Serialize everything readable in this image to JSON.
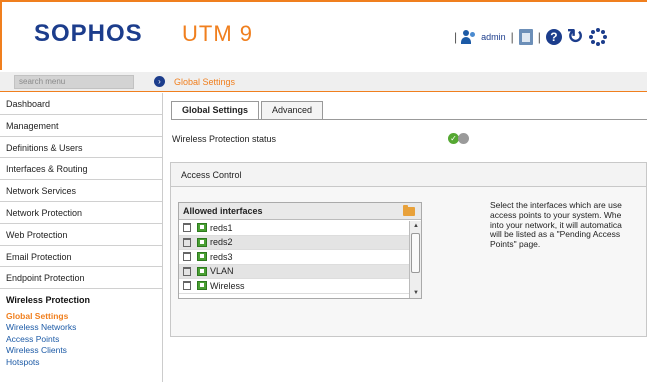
{
  "header": {
    "brand": "SOPHOS",
    "product": "UTM 9",
    "user": "admin"
  },
  "search": {
    "placeholder": "search menu"
  },
  "breadcrumb": "Global Settings",
  "sidebar": {
    "items": [
      {
        "label": "Dashboard"
      },
      {
        "label": "Management"
      },
      {
        "label": "Definitions & Users"
      },
      {
        "label": "Interfaces & Routing"
      },
      {
        "label": "Network Services"
      },
      {
        "label": "Network Protection"
      },
      {
        "label": "Web Protection"
      },
      {
        "label": "Email Protection"
      },
      {
        "label": "Endpoint Protection"
      },
      {
        "label": "Wireless Protection"
      }
    ],
    "subitems": [
      {
        "label": "Global Settings"
      },
      {
        "label": "Wireless Networks"
      },
      {
        "label": "Access Points"
      },
      {
        "label": "Wireless Clients"
      },
      {
        "label": "Hotspots"
      }
    ]
  },
  "tabs": [
    {
      "label": "Global Settings"
    },
    {
      "label": "Advanced"
    }
  ],
  "status": {
    "label": "Wireless Protection status",
    "enabled": true
  },
  "access_control": {
    "title": "Access Control",
    "list_title": "Allowed interfaces",
    "interfaces": [
      "reds1",
      "reds2",
      "reds3",
      "VLAN",
      "Wireless"
    ],
    "help_lines": [
      "Select the interfaces which are use",
      "access points to your system. Whe",
      "into your network, it will automatica",
      "will be listed as a \"Pending Access",
      "Points\" page."
    ]
  },
  "colors": {
    "accent": "#f07f1e",
    "brand": "#1c3d8c",
    "link": "#1c5aa6"
  }
}
